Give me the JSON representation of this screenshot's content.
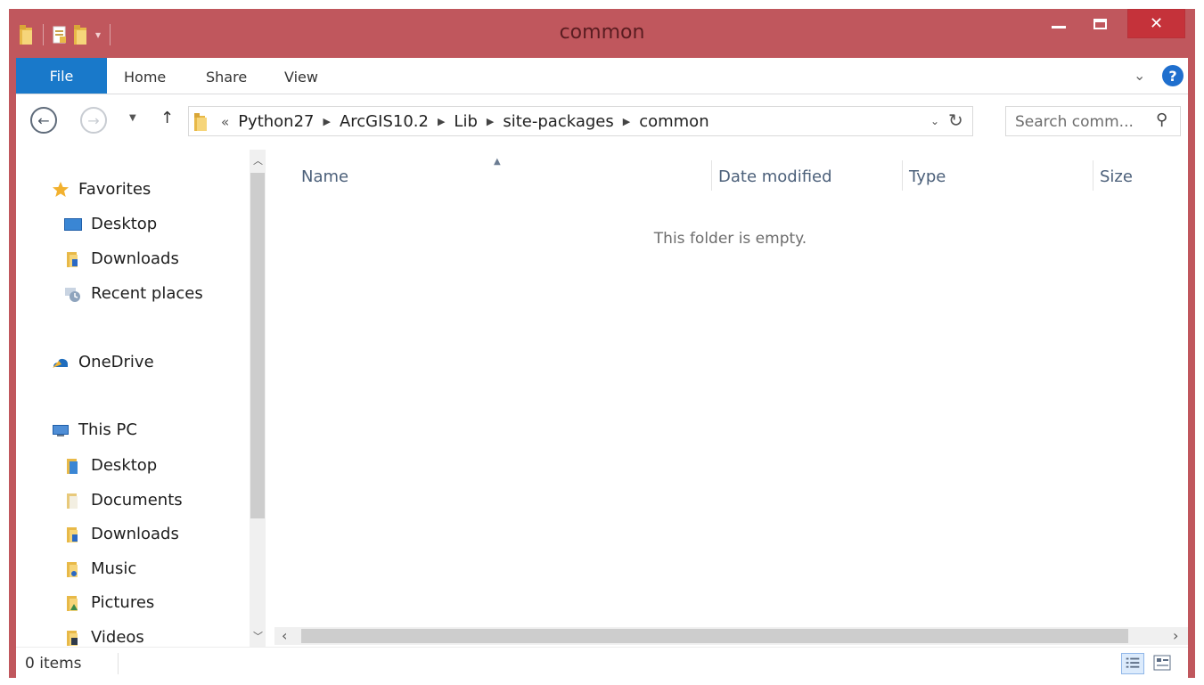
{
  "window": {
    "title": "common",
    "accent_color": "#c0575d",
    "close_color": "#c5323a"
  },
  "quick_access": {
    "icons": [
      "folder-icon",
      "properties-icon",
      "new-folder-icon",
      "customize-arrow-icon"
    ]
  },
  "ribbon": {
    "file_label": "File",
    "tabs": [
      "Home",
      "Share",
      "View"
    ],
    "help_label": "?"
  },
  "address": {
    "overflow": "«",
    "crumbs": [
      "Python27",
      "ArcGIS10.2",
      "Lib",
      "site-packages",
      "common"
    ]
  },
  "search": {
    "placeholder": "Search comm..."
  },
  "nav_pane": {
    "favorites": "Favorites",
    "favorites_items": [
      "Desktop",
      "Downloads",
      "Recent places"
    ],
    "onedrive": "OneDrive",
    "this_pc": "This PC",
    "pc_items": [
      "Desktop",
      "Documents",
      "Downloads",
      "Music",
      "Pictures",
      "Videos"
    ]
  },
  "file_pane": {
    "columns": [
      "Name",
      "Date modified",
      "Type",
      "Size"
    ],
    "empty_message": "This folder is empty."
  },
  "status": {
    "items": "0 items"
  }
}
